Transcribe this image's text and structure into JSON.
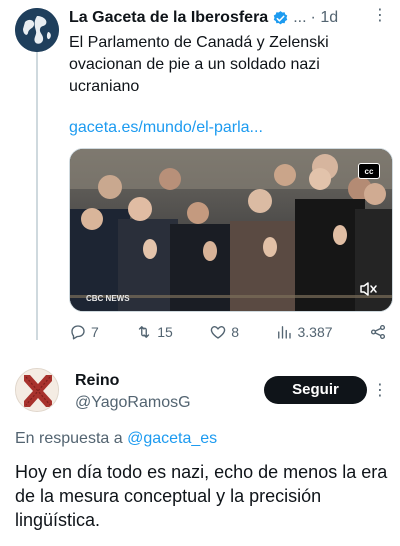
{
  "tweet": {
    "author_name": "La Gaceta de la Iberosfera",
    "separator": "...",
    "time": "· 1d",
    "more_icon": "more-vertical-icon",
    "text": "El Parlamento de Canadá y Zelenski ovacionan de pie a un soldado nazi ucraniano",
    "link": "gaceta.es/mundo/el-parla...",
    "media": {
      "cc_label": "cc",
      "watermark": "CBC NEWS",
      "mute_icon": "volume-muted-icon"
    },
    "actions": {
      "reply_count": "7",
      "retweet_count": "15",
      "like_count": "8",
      "views_count": "3.387"
    }
  },
  "reply": {
    "author_name": "Reino",
    "handle": "@YagoRamosG",
    "follow_label": "Seguir",
    "in_reply_prefix": "En respuesta a ",
    "in_reply_mention": "@gaceta_es",
    "text": "Hoy en día todo es nazi, echo de menos la era de la mesura conceptual y la precisión lingüística."
  },
  "colors": {
    "link": "#1d9bf0",
    "secondary_text": "#536471",
    "primary_text": "#0f1419",
    "verified": "#1d9bf0",
    "follow_button": "#0f1419"
  }
}
